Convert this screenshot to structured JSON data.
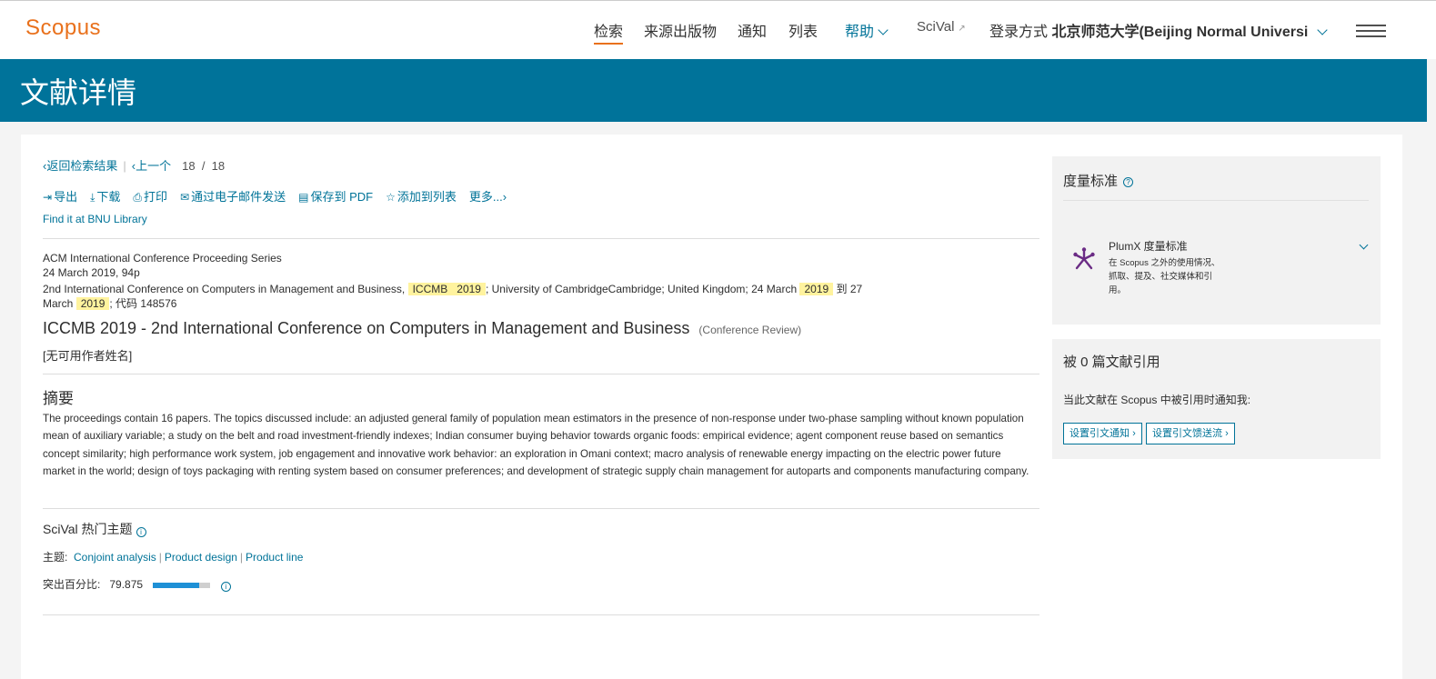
{
  "header": {
    "logo": "Scopus",
    "nav": {
      "search": "检索",
      "sources": "来源出版物",
      "alerts": "通知",
      "lists": "列表",
      "help": "帮助",
      "scival": "SciVal",
      "login_prefix": "登录方式",
      "institution": "北京师范大学(Beijing Normal Universi"
    }
  },
  "banner": {
    "title": "文献详情"
  },
  "doc_nav": {
    "back": "返回检索结果",
    "previous": "上一个",
    "current": "18",
    "slash": "/",
    "total": "18"
  },
  "actions": {
    "export": "导出",
    "download": "下载",
    "print": "打印",
    "email": "通过电子邮件发送",
    "save_pdf": "保存到 PDF",
    "add_list": "添加到列表",
    "more": "更多..."
  },
  "find_it": "Find it at BNU Library",
  "source": {
    "series": "ACM International Conference Proceeding Series",
    "date_pages": "24 March 2019, 94p",
    "conf_pre": "2nd International Conference on Computers in Management and Business,",
    "conf_hl1": "ICCMB",
    "conf_hl2": "2019",
    "conf_mid": "; University of CambridgeCambridge; United Kingdom; 24 March",
    "conf_hl3": "2019",
    "conf_to": "到 27",
    "conf_march": "March",
    "conf_hl4": "2019",
    "conf_code": "; 代码 148576"
  },
  "document": {
    "title": "ICCMB 2019 - 2nd International Conference on Computers in Management and Business",
    "type": "(Conference Review)",
    "authors": "[无可用作者姓名]"
  },
  "abstract": {
    "heading": "摘要",
    "text": "The proceedings contain 16 papers. The topics discussed include: an adjusted general family of population mean estimators in the presence of non-response under two-phase sampling without known population mean of auxiliary variable; a study on the belt and road investment-friendly indexes; Indian consumer buying behavior towards organic foods: empirical evidence; agent component reuse based on semantics concept similarity; high performance work system, job engagement and innovative work behavior: an exploration in Omani context; macro analysis of renewable energy impacting on the electric power future market in the world; design of toys packaging with renting system based on consumer preferences; and development of strategic supply chain management for autoparts and components manufacturing company."
  },
  "scival": {
    "heading": "SciVal 热门主题",
    "topic_label": "主题:",
    "topics": [
      "Conjoint analysis",
      "Product design",
      "Product line"
    ],
    "percentile_label": "突出百分比:",
    "percentile_value": "79.875",
    "percentile_fraction": 0.79875
  },
  "metrics": {
    "heading": "度量标准",
    "plumx_title": "PlumX 度量标准",
    "plumx_desc": "在 Scopus 之外的使用情况、抓取、提及、社交媒体和引用。"
  },
  "citations": {
    "heading": "被 0 篇文献引用",
    "note": "当此文献在 Scopus 中被引用时通知我:",
    "alert_btn": "设置引文通知",
    "feed_btn": "设置引文馈送流"
  },
  "colors": {
    "brand_orange": "#e9711c",
    "banner_blue": "#00739a",
    "link_blue": "#007398",
    "highlight": "#fff39e",
    "plumx_purple": "#6b2c85"
  }
}
